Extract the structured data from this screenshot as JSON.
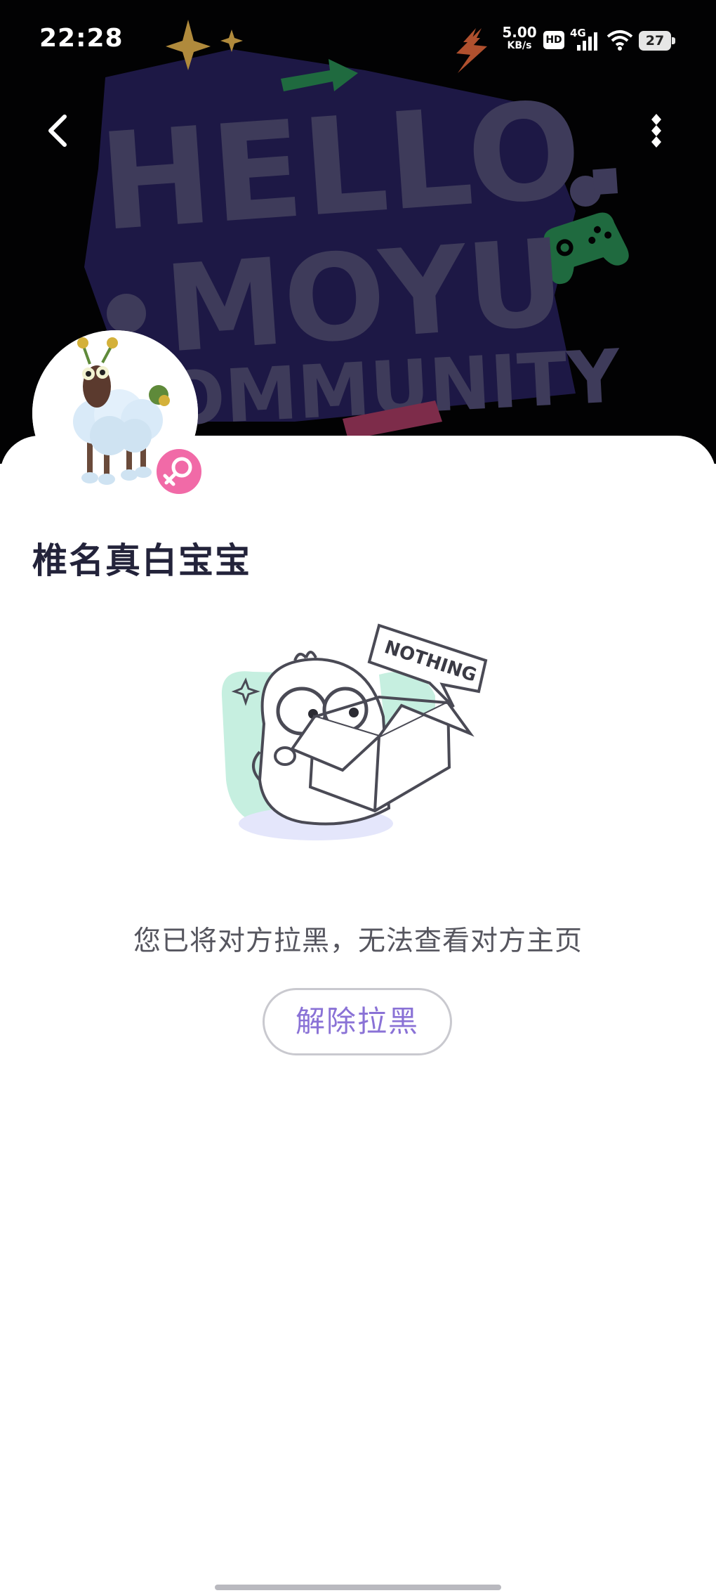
{
  "status_bar": {
    "time": "22:28",
    "net_speed_value": "5.00",
    "net_speed_unit": "KB/s",
    "hd_label": "HD",
    "network_label": "4G",
    "battery_level": "27"
  },
  "banner": {
    "line1": "HELLO.",
    "line2": "MOYU",
    "line3": "COMMUNITY",
    "colors": {
      "background": "#020203",
      "text": "#3e3b5a",
      "blob": "#1d1845"
    }
  },
  "nav": {
    "back_icon": "chevron-left-icon",
    "more_icon": "vertical-dots-icon"
  },
  "profile": {
    "username": "椎名真白宝宝",
    "gender_icon": "female-symbol-icon",
    "gender_color": "#f16aa7"
  },
  "empty_state": {
    "bubble_text": "NOTHING",
    "message": "您已将对方拉黑，无法查看对方主页",
    "unblock_label": "解除拉黑",
    "accent_color": "#8a72d6"
  }
}
